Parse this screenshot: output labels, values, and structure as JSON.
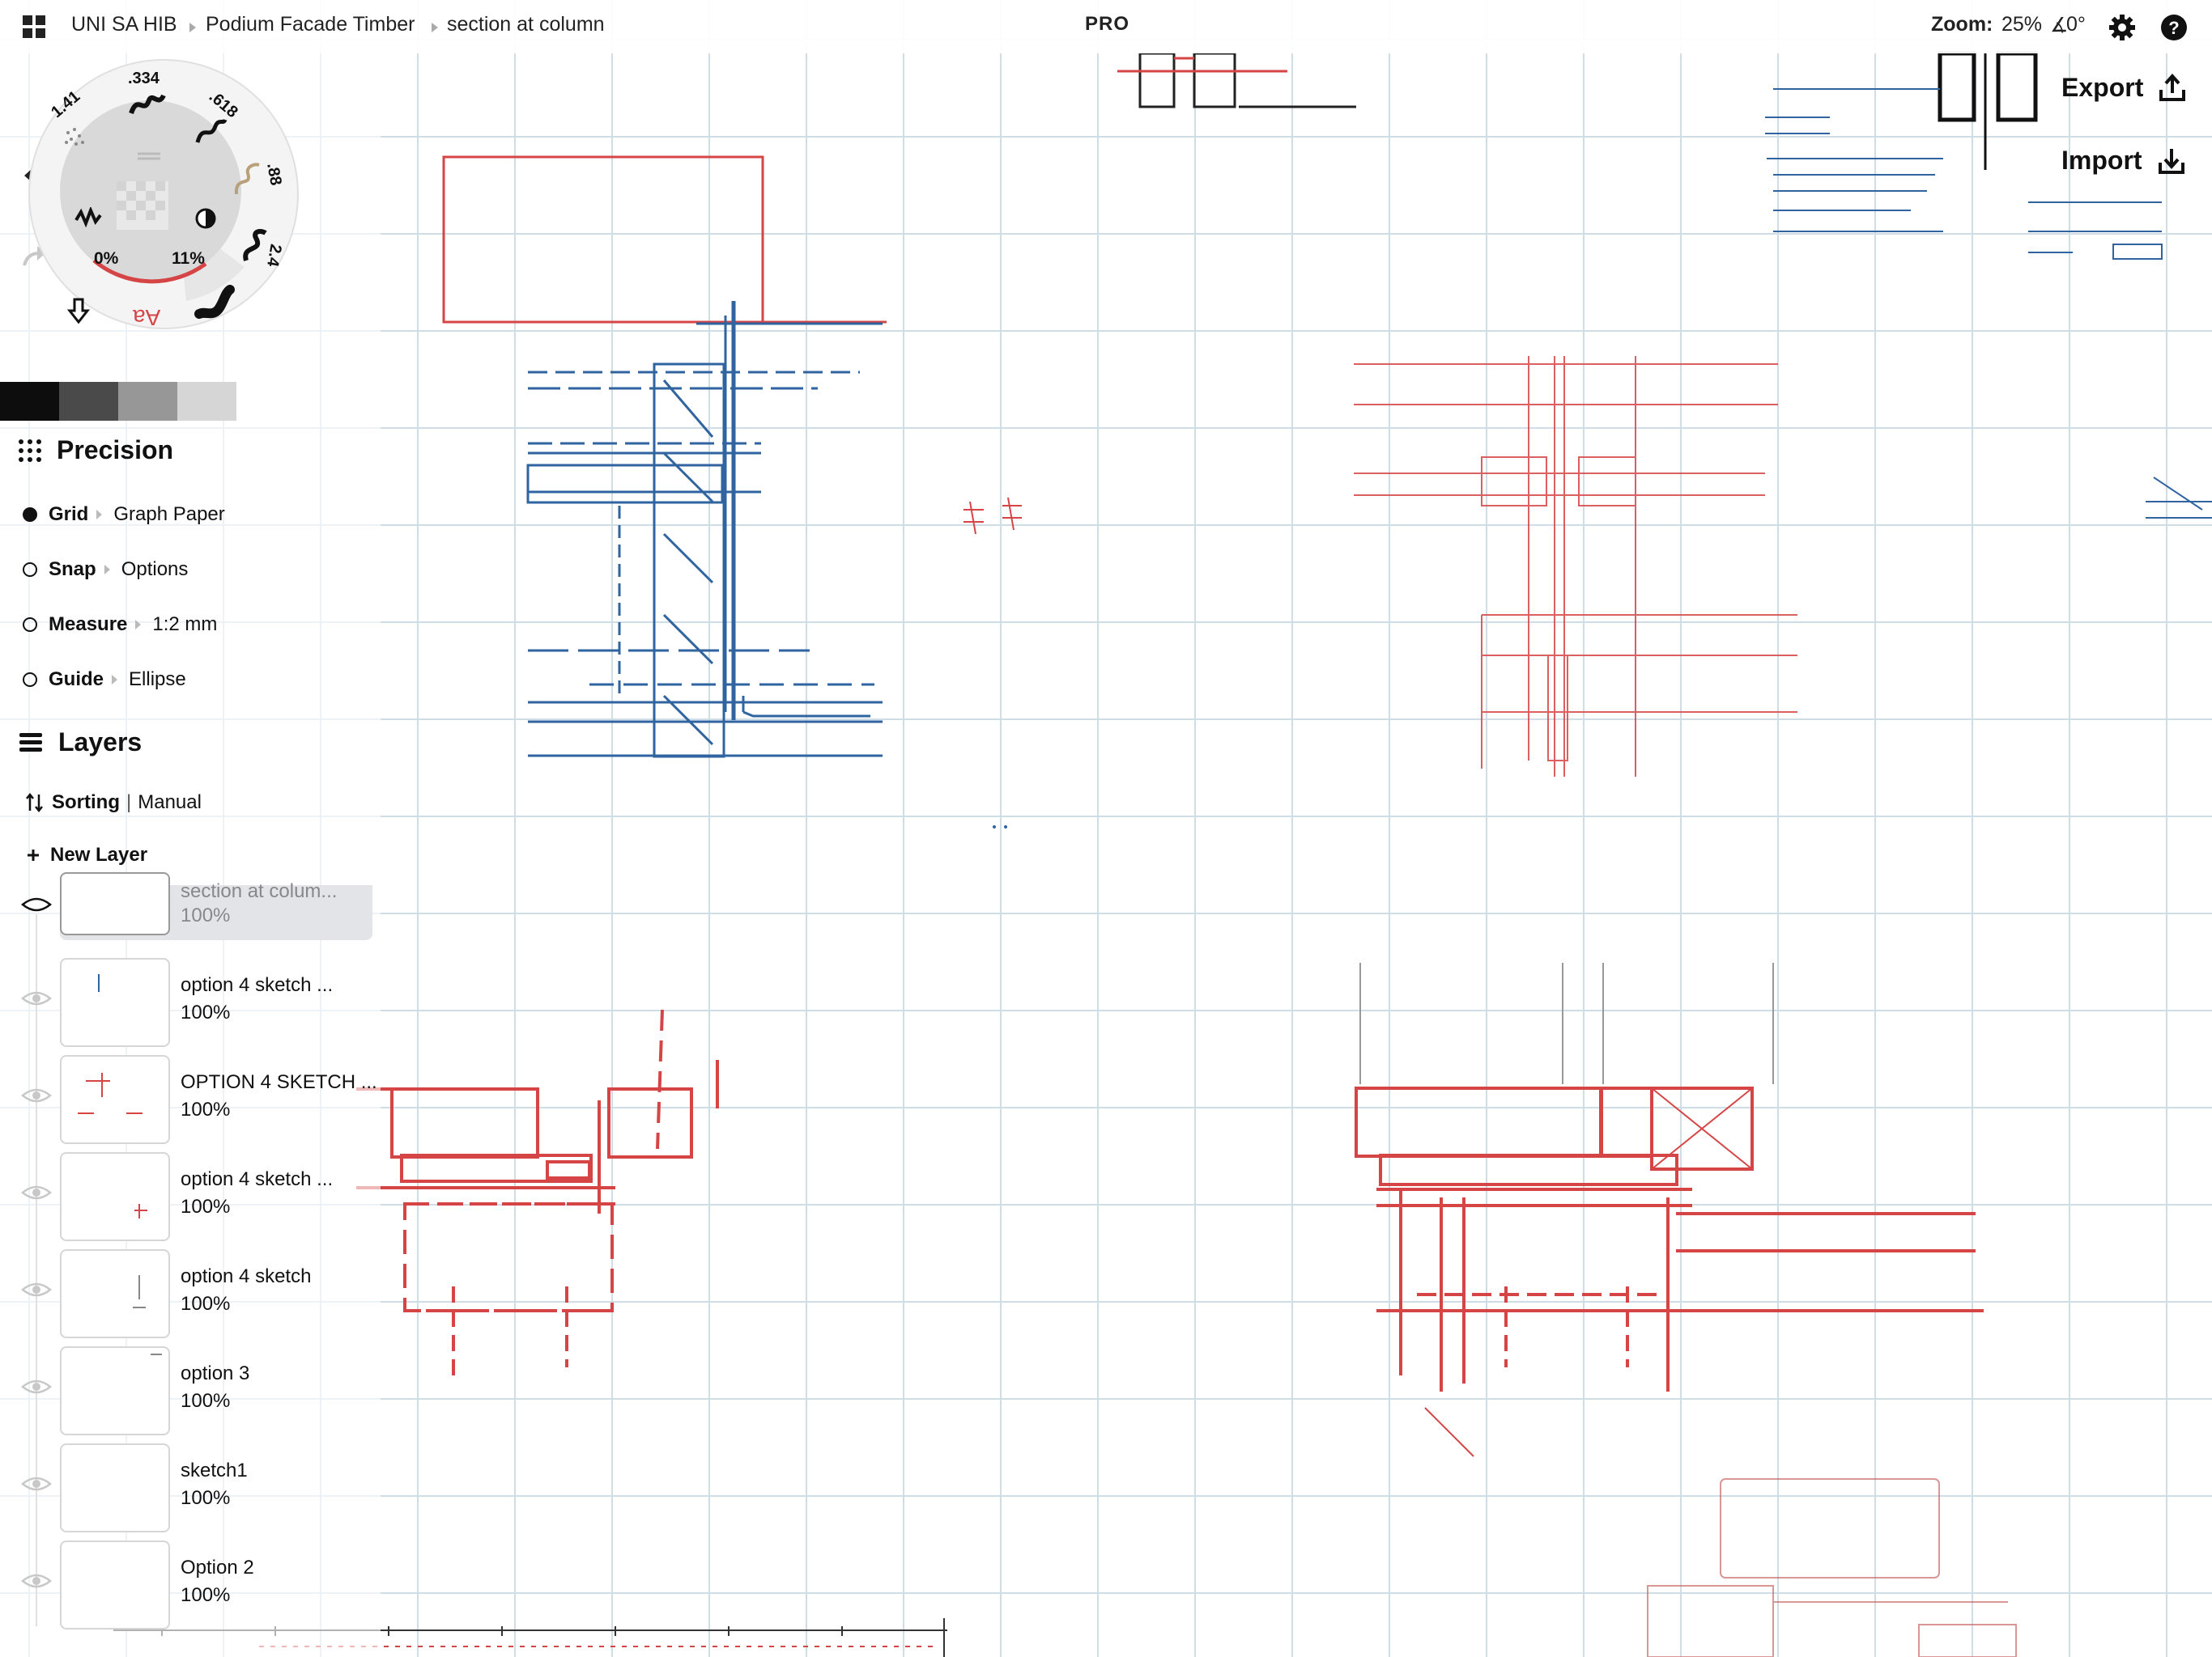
{
  "header": {
    "app_title": "UNI SA HIB",
    "breadcrumb": [
      "Podium Facade Timber",
      "section at column"
    ],
    "pro_badge": "PRO",
    "zoom_label": "Zoom:",
    "zoom_value": "25%",
    "rotation_value": "0°"
  },
  "brush_wheel": {
    "sizes": [
      ".334",
      ".618",
      ".88",
      "2.4",
      "1.41"
    ],
    "opacity_value": "0%",
    "smoothing_value": "11%",
    "text_tool_label": "Aa"
  },
  "swatches": [
    "#0d0d0d",
    "#4a4a4a",
    "#979797",
    "#d6d6d6"
  ],
  "precision": {
    "title": "Precision",
    "rows": [
      {
        "name": "Grid",
        "value": "Graph Paper",
        "on": true
      },
      {
        "name": "Snap",
        "value": "Options",
        "on": false
      },
      {
        "name": "Measure",
        "value": "1:2 mm",
        "on": false
      },
      {
        "name": "Guide",
        "value": "Ellipse",
        "on": false
      }
    ]
  },
  "layers": {
    "title": "Layers",
    "sorting_label": "Sorting",
    "sorting_value": "Manual",
    "new_layer_label": "New Layer",
    "items": [
      {
        "name": "section at colum...",
        "opacity": "100%"
      },
      {
        "name": "option 4 sketch ...",
        "opacity": "100%"
      },
      {
        "name": "OPTION 4 SKETCH ...",
        "opacity": "100%"
      },
      {
        "name": "option 4 sketch ...",
        "opacity": "100%"
      },
      {
        "name": "option 4 sketch",
        "opacity": "100%"
      },
      {
        "name": "option 3",
        "opacity": "100%"
      },
      {
        "name": "sketch1",
        "opacity": "100%"
      },
      {
        "name": "Option 2",
        "opacity": "100%"
      }
    ]
  },
  "actions": {
    "export_label": "Export",
    "import_label": "Import"
  },
  "colors": {
    "ink_blue": "#2f64a0",
    "ink_red": "#d64545",
    "grid": "#cfdde6"
  }
}
